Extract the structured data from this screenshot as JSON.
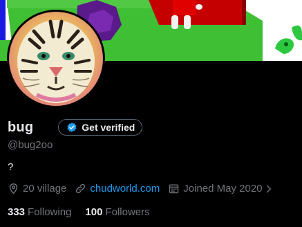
{
  "profile": {
    "display_name": "bug",
    "handle": "@bug2oo",
    "bio": "?",
    "verify_label": "Get verified"
  },
  "meta": {
    "location": "20 village",
    "website": "chudworld.com",
    "joined": "Joined May 2020"
  },
  "stats": {
    "following_count": "333",
    "following_label": "Following",
    "followers_count": "100",
    "followers_label": "Followers"
  },
  "icons": [
    "location-pin-icon",
    "link-icon",
    "calendar-icon",
    "chevron-right-icon",
    "verified-badge-icon"
  ],
  "colors": {
    "background": "#000000",
    "text_primary": "#e7e9ea",
    "text_secondary": "#71767b",
    "accent": "#1d9bf0",
    "button_border": "#536471"
  }
}
